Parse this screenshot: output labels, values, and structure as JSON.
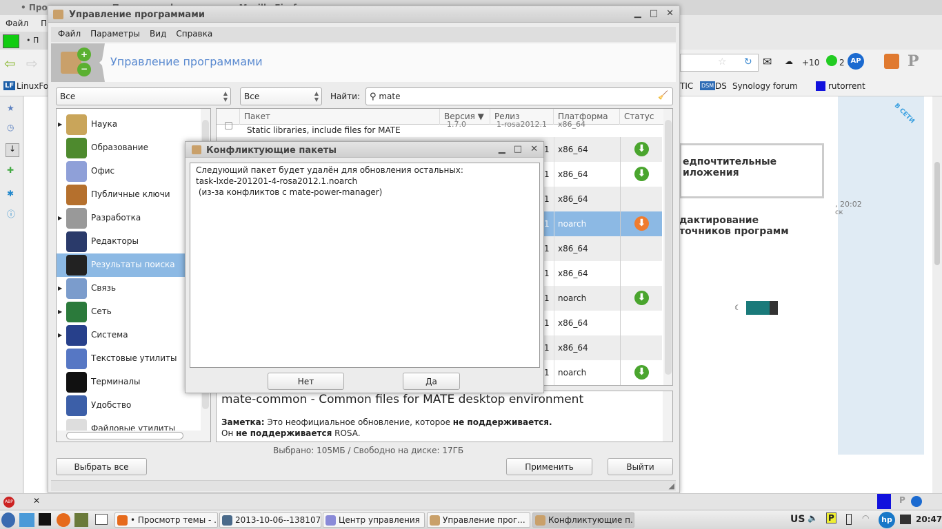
{
  "firefox": {
    "title": "• Просмотр темы - Поделись оформлением - Mozilla Firefox",
    "menu": [
      "Файл",
      "Пр"
    ],
    "tab_label": "• П",
    "bookmarks": [
      "LinuxFo",
      "TIC",
      "DS",
      "Synology forum",
      "rutorrent"
    ],
    "weather": "+10",
    "count_badge": "2",
    "page": {
      "heading1": "едпочтительные",
      "heading1b": "иложения",
      "time": ", 20:02",
      "sub": "ск",
      "heading2": "дактирование",
      "heading2b": "точников программ",
      "ribbon": "В СЕТИ"
    }
  },
  "app": {
    "title": "Управление программами",
    "menu": [
      "Файл",
      "Параметры",
      "Вид",
      "Справка"
    ],
    "banner_title": "Управление программами",
    "filters": {
      "group": "Все",
      "state": "Все",
      "search_label": "Найти:",
      "search_value": "mate"
    },
    "categories": [
      {
        "label": "Наука",
        "expandable": true,
        "color": "#c9a55a"
      },
      {
        "label": "Образование",
        "expandable": false,
        "color": "#4e8a2e"
      },
      {
        "label": "Офис",
        "expandable": false,
        "color": "#8fa0d8"
      },
      {
        "label": "Публичные ключи",
        "expandable": false,
        "color": "#b5702d"
      },
      {
        "label": "Разработка",
        "expandable": true,
        "color": "#999999"
      },
      {
        "label": "Редакторы",
        "expandable": false,
        "color": "#2a3a6a"
      },
      {
        "label": "Результаты поиска",
        "expandable": false,
        "color": "#222222",
        "selected": true
      },
      {
        "label": "Связь",
        "expandable": true,
        "color": "#7b9ccc"
      },
      {
        "label": "Сеть",
        "expandable": true,
        "color": "#2b7a3b"
      },
      {
        "label": "Система",
        "expandable": true,
        "color": "#27408b"
      },
      {
        "label": "Текстовые утилиты",
        "expandable": false,
        "color": "#5677c4"
      },
      {
        "label": "Терминалы",
        "expandable": false,
        "color": "#111111"
      },
      {
        "label": "Удобство",
        "expandable": false,
        "color": "#3c5fa8"
      },
      {
        "label": "Файловые утилиты",
        "expandable": false,
        "color": "#dddddd"
      }
    ],
    "table": {
      "columns": [
        "Пакет",
        "Версия ▼",
        "Релиз",
        "Платформа",
        "Статус"
      ],
      "first_row": {
        "description": "Static libraries, include files for MATE",
        "version": "1.7.0",
        "release": "1-rosa2012.1",
        "platform": "x86_64"
      },
      "rows": [
        {
          "release": "1",
          "platform": "x86_64",
          "status": "install"
        },
        {
          "release": "1",
          "platform": "x86_64",
          "status": "install"
        },
        {
          "release": "1",
          "platform": "x86_64",
          "status": ""
        },
        {
          "release": "1",
          "platform": "noarch",
          "status": "remove",
          "selected": true
        },
        {
          "release": "1",
          "platform": "x86_64",
          "status": ""
        },
        {
          "release": "1",
          "platform": "x86_64",
          "status": ""
        },
        {
          "release": "1",
          "platform": "noarch",
          "status": "install"
        },
        {
          "release": "1",
          "platform": "x86_64",
          "status": ""
        },
        {
          "release": "1",
          "platform": "x86_64",
          "status": ""
        },
        {
          "release": "1",
          "platform": "noarch",
          "status": "install"
        }
      ]
    },
    "details": {
      "title": "mate-common - Common files for MATE desktop environment",
      "note_label": "Заметка:",
      "note_text1": " Это неофициальное обновление, которое ",
      "note_bold1": "не поддерживается.",
      "note_text2": "Он ",
      "note_bold2": "не поддерживается",
      "note_text3": " ROSA."
    },
    "status": "Выбрано: 105МБ / Свободно на диске: 17ГБ",
    "buttons": {
      "select_all": "Выбрать все",
      "apply": "Применить",
      "quit": "Выйти"
    }
  },
  "dialog": {
    "title": "Конфликтующие пакеты",
    "lines": [
      "Следующий пакет будет удалён для обновления остальных:",
      "task-lxde-201201-4-rosa2012.1.noarch",
      " (из-за конфликтов с mate-power-manager)"
    ],
    "no": "Нет",
    "yes": "Да"
  },
  "taskbar": {
    "items": [
      "• Просмотр темы - ...",
      "2013-10-06--138107...",
      "Центр управления",
      "Управление прог...",
      "Конфликтующие п..."
    ],
    "layout": "US",
    "time": "20:47"
  },
  "colors": {
    "install": "#4aa52e",
    "remove": "#f07c2e",
    "selection": "#8cb9e4"
  }
}
